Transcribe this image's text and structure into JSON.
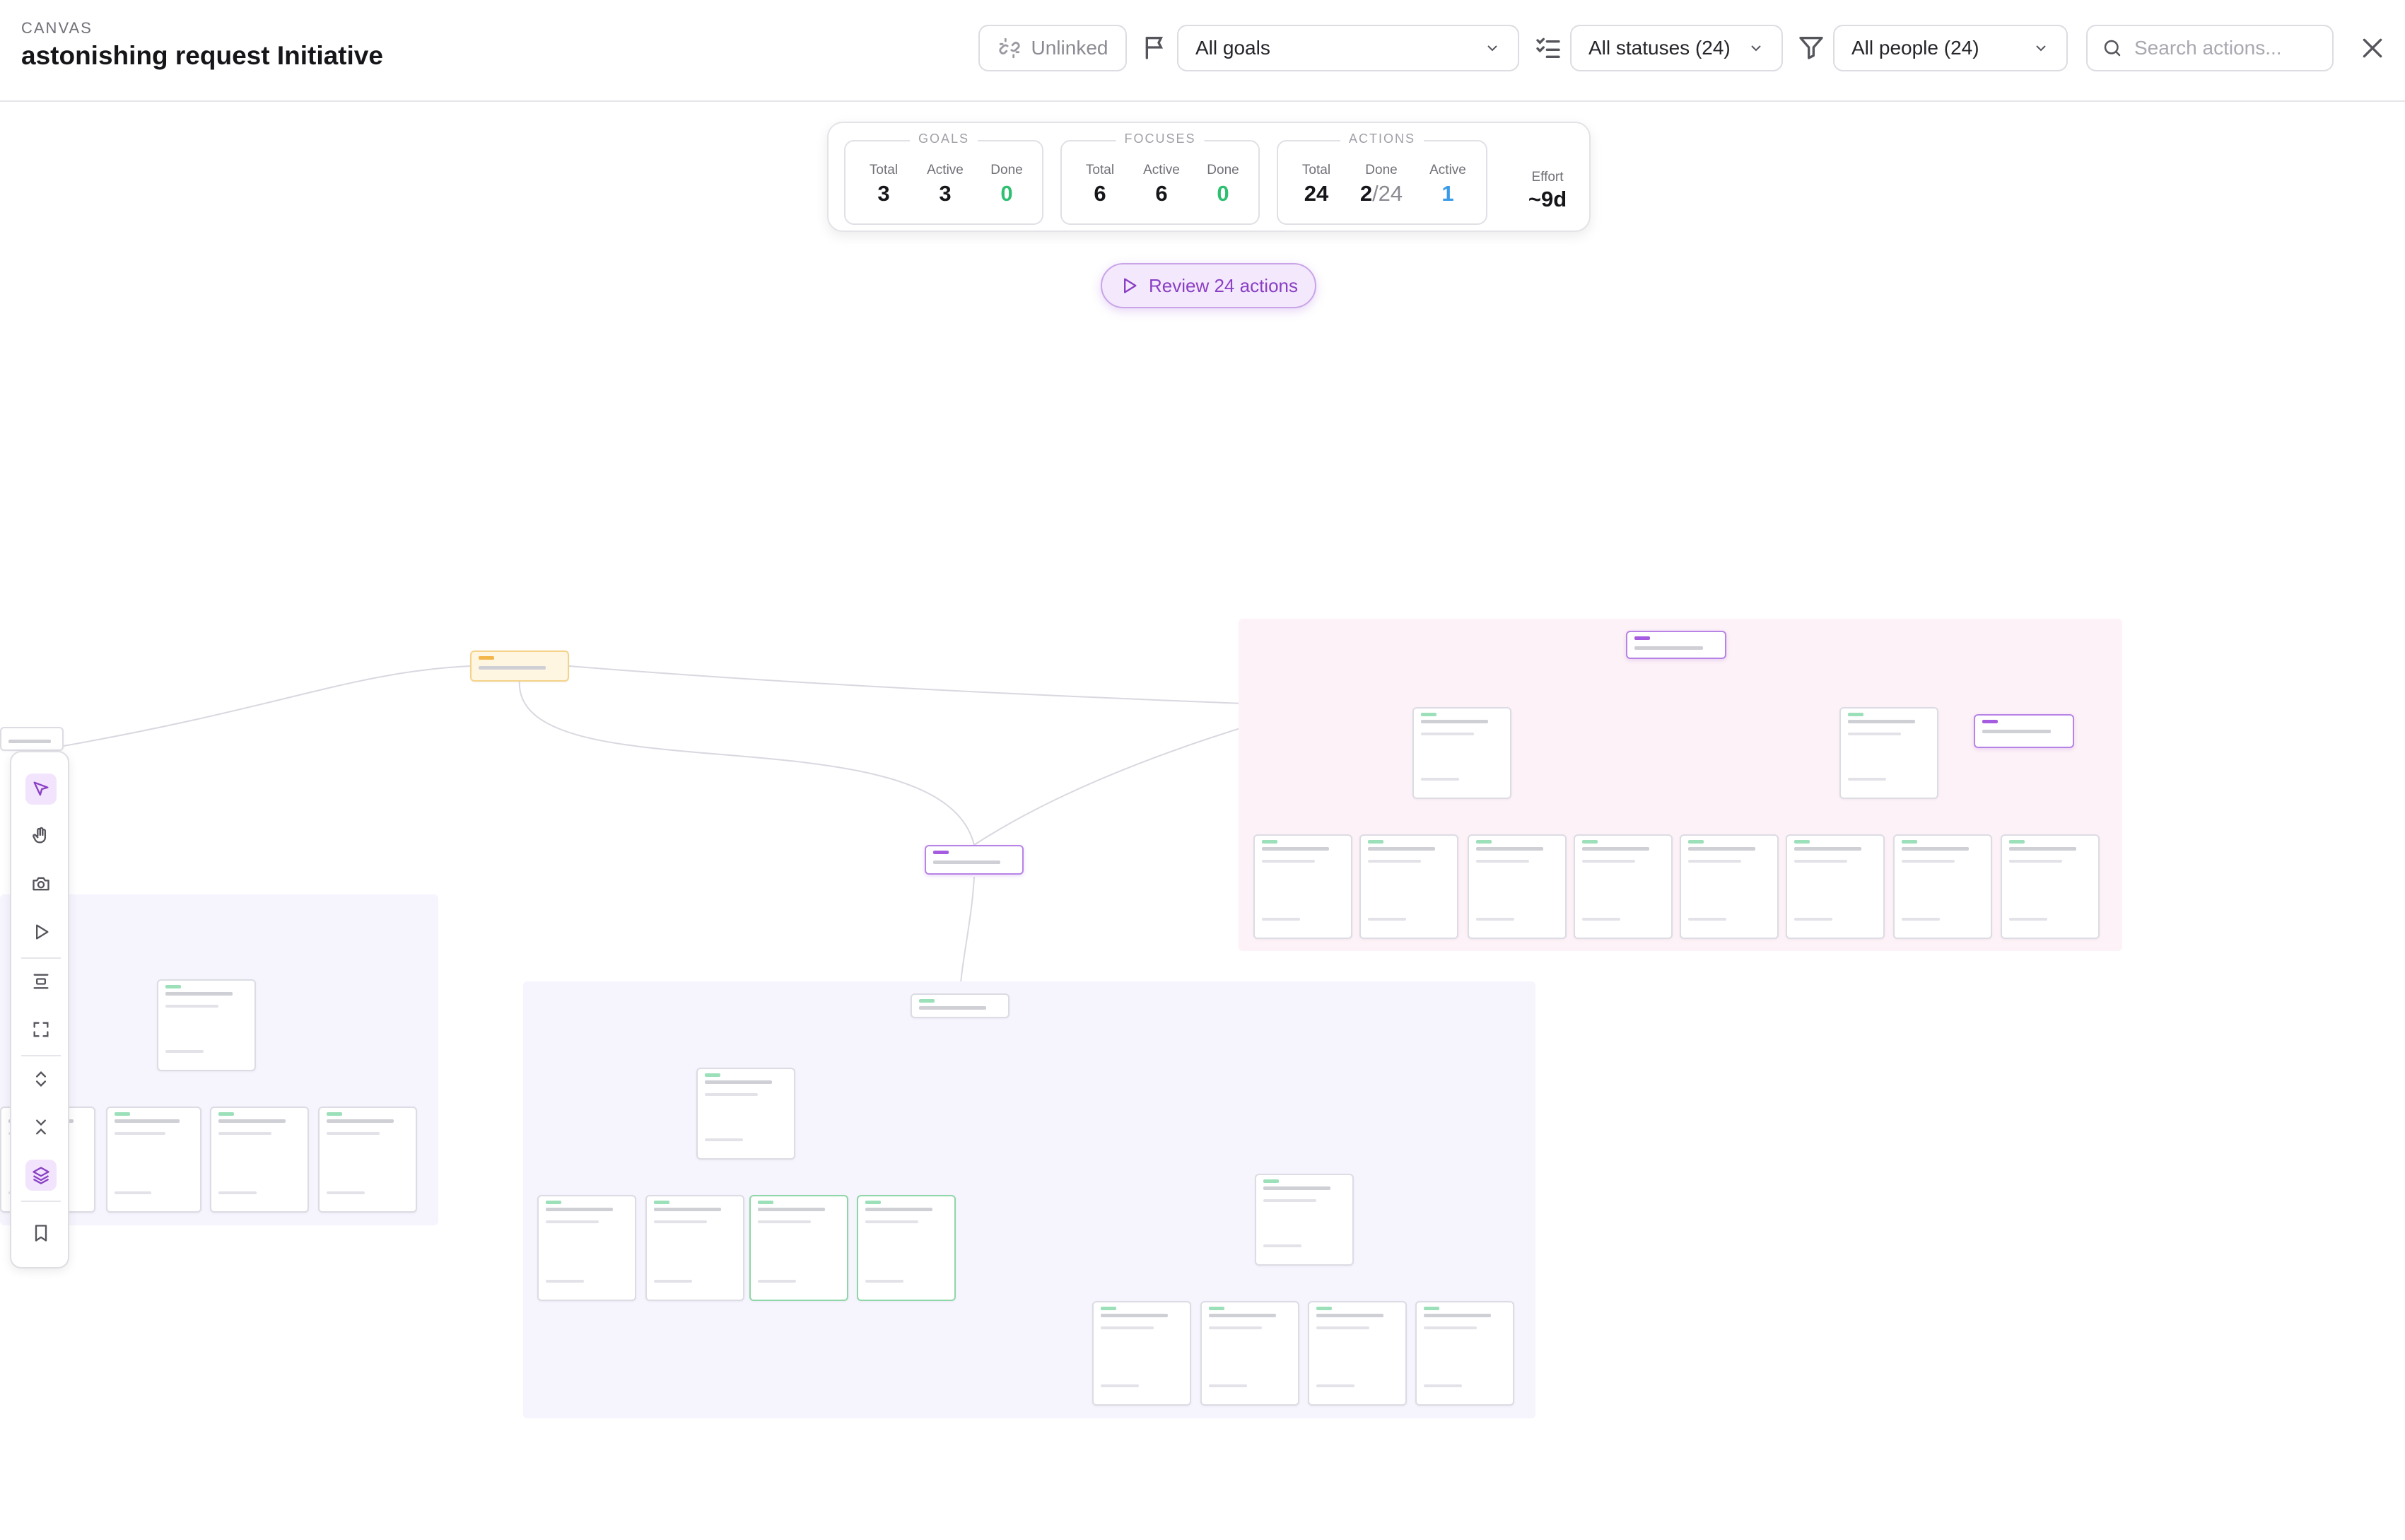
{
  "header": {
    "breadcrumb": "CANVAS",
    "title": "astonishing request Initiative",
    "unlinked_label": "Unlinked",
    "goals_filter": "All goals",
    "status_filter": "All statuses (24)",
    "people_filter": "All people (24)",
    "search_placeholder": "Search actions...",
    "icons": [
      "unlink-icon",
      "flag-icon",
      "checklist-icon",
      "filter-icon",
      "search-icon",
      "close-icon"
    ]
  },
  "stats": {
    "goals": {
      "label": "GOALS",
      "total_label": "Total",
      "total": "3",
      "active_label": "Active",
      "active": "3",
      "done_label": "Done",
      "done": "0"
    },
    "focuses": {
      "label": "FOCUSES",
      "total_label": "Total",
      "total": "6",
      "active_label": "Active",
      "active": "6",
      "done_label": "Done",
      "done": "0"
    },
    "actions": {
      "label": "ACTIONS",
      "total_label": "Total",
      "total": "24",
      "done_label": "Done",
      "done": "2",
      "done_of": "/24",
      "active_label": "Active",
      "active": "1"
    },
    "effort": {
      "label": "Effort",
      "value": "~9d"
    }
  },
  "review_button": "Review 24 actions",
  "toolbar": {
    "tools": [
      "select-icon",
      "hand-icon",
      "camera-icon",
      "play-icon",
      "align-icon",
      "fit-view-icon",
      "expand-icon",
      "collapse-icon",
      "layers-icon",
      "bookmark-icon"
    ],
    "active_tools": [
      "select-icon",
      "layers-icon"
    ]
  },
  "colors": {
    "accent": "#a65ce0",
    "done_green": "#2fbf71",
    "active_blue": "#3a9be8",
    "goal_region": "#fdf2f7",
    "focus_region": "#f6f4fd"
  }
}
